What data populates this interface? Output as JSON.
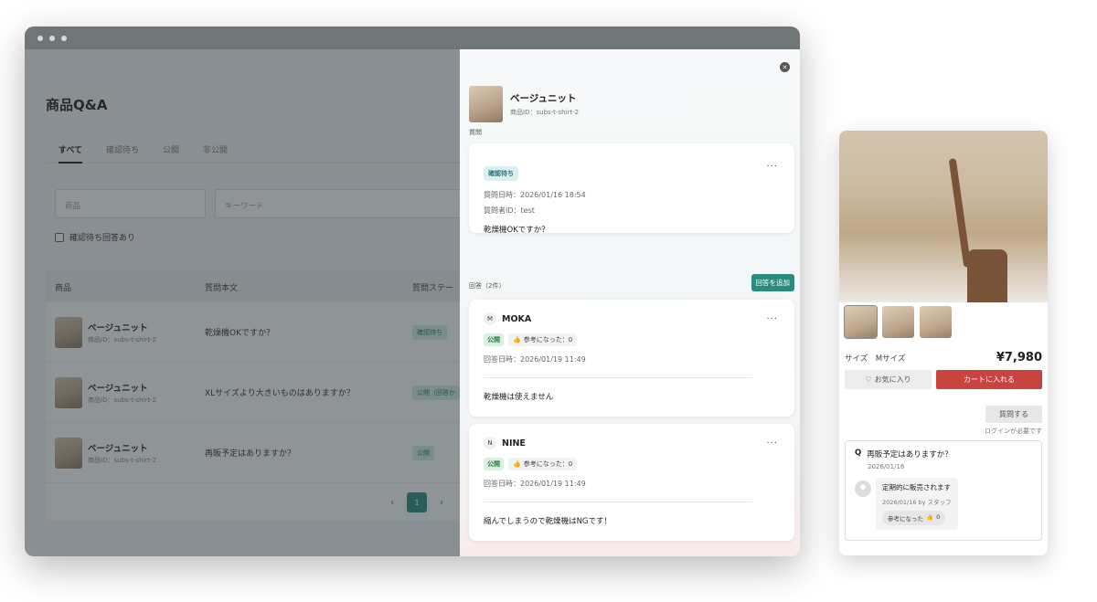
{
  "admin": {
    "page_title": "商品Q&A",
    "tabs": [
      "すべて",
      "確認待ち",
      "公開",
      "非公開"
    ],
    "filters": {
      "product_placeholder": "商品",
      "keyword_placeholder": "キーワード"
    },
    "checkbox_label": "確認待ち回答あり",
    "table": {
      "headers": {
        "product": "商品",
        "body": "質問本文",
        "status": "質問ステー"
      },
      "rows": [
        {
          "name": "ベージュニット",
          "id": "商品ID：subs-t-shirt-2",
          "question": "乾燥機OKですか？",
          "status": "確認待ち"
        },
        {
          "name": "ベージュニット",
          "id": "商品ID：subs-t-shirt-2",
          "question": "XLサイズより大きいものはありますか？",
          "status": "公開（回答か"
        },
        {
          "name": "ベージュニット",
          "id": "商品ID：subs-t-shirt-2",
          "question": "再販予定はありますか？",
          "status": "公開"
        }
      ]
    },
    "pagination": {
      "prev": "‹",
      "current": "1",
      "next": "›"
    }
  },
  "drawer": {
    "product_name": "ベージュニット",
    "product_id": "商品ID：subs-t-shirt-2",
    "question_section": "質問",
    "question": {
      "status": "確認待ち",
      "date": "質問日時：2026/01/16 18:54",
      "asker": "質問者ID：test",
      "text": "乾燥機OKですか？"
    },
    "answers_section": "回答（2件）",
    "add_answer": "回答を追加",
    "answers": [
      {
        "initial": "M",
        "name": "MOKA",
        "status": "公開",
        "helpful": "参考になった：0",
        "date": "回答日時：2026/01/19 11:49",
        "text": "乾燥機は使えません"
      },
      {
        "initial": "N",
        "name": "NINE",
        "status": "公開",
        "helpful": "参考になった：0",
        "date": "回答日時：2026/01/19 11:49",
        "text": "縮んでしまうので乾燥機はNGです！"
      }
    ],
    "more": "···"
  },
  "mobile": {
    "size_label": "サイズ　Mサイズ",
    "price": "¥7,980",
    "favorite": "お気に入り",
    "cart": "カートに入れる",
    "ask": "質問する",
    "login_note": "ログインが必要です",
    "qa": {
      "q_mark": "Q",
      "question": "再販予定はありますか？",
      "date": "2026/01/16",
      "answer": "定期的に販売されます",
      "answer_meta": "2026/01/16  by スタッフ",
      "helpful": "参考になった",
      "helpful_count": "0"
    }
  },
  "colors": {
    "accent": "#2a8c7f",
    "cart": "#c9433f",
    "overlay": "#4b565a"
  },
  "icons": [
    "close-icon",
    "more-icon",
    "thumbs-up-icon",
    "heart-icon",
    "avatar-icon",
    "chevron-left-icon",
    "chevron-right-icon"
  ]
}
